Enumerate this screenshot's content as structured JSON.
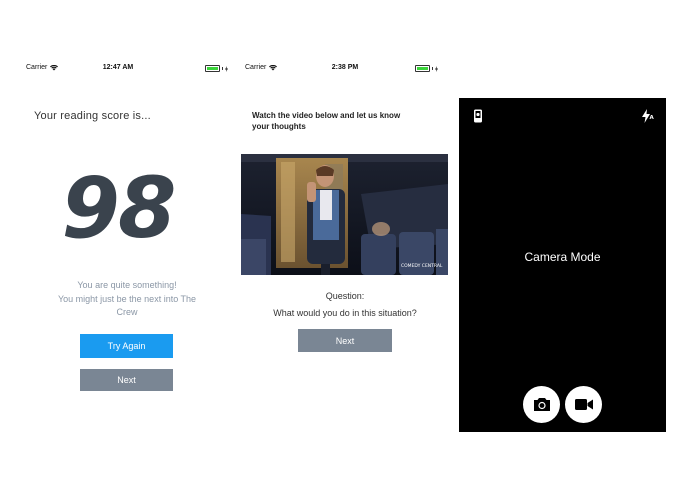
{
  "screen1": {
    "status": {
      "carrier": "Carrier",
      "time": "12:47 AM"
    },
    "heading": "Your reading score is...",
    "score": "98",
    "message_line1": "You are quite something!",
    "message_line2": "You might just be the next into The",
    "message_line3": "Crew",
    "try_again_label": "Try Again",
    "next_label": "Next"
  },
  "screen2": {
    "status": {
      "carrier": "Carrier",
      "time": "2:38 PM"
    },
    "heading_line1": "Watch the video below and let us know",
    "heading_line2": "your thoughts",
    "video_watermark": "COMEDY CENTRAL",
    "question_label": "Question:",
    "question_text": "What would you do in this situation?",
    "next_label": "Next"
  },
  "screen3": {
    "title": "Camera Mode",
    "icons": [
      "switch-camera-icon",
      "flash-auto-icon",
      "camera-icon",
      "video-icon"
    ]
  },
  "colors": {
    "primary_button": "#1a9bf0",
    "secondary_button": "#7a8694",
    "score_text": "#3a434d",
    "message_text": "#8b97a6",
    "battery": "#3ad43a",
    "camera_bg": "#000000"
  }
}
